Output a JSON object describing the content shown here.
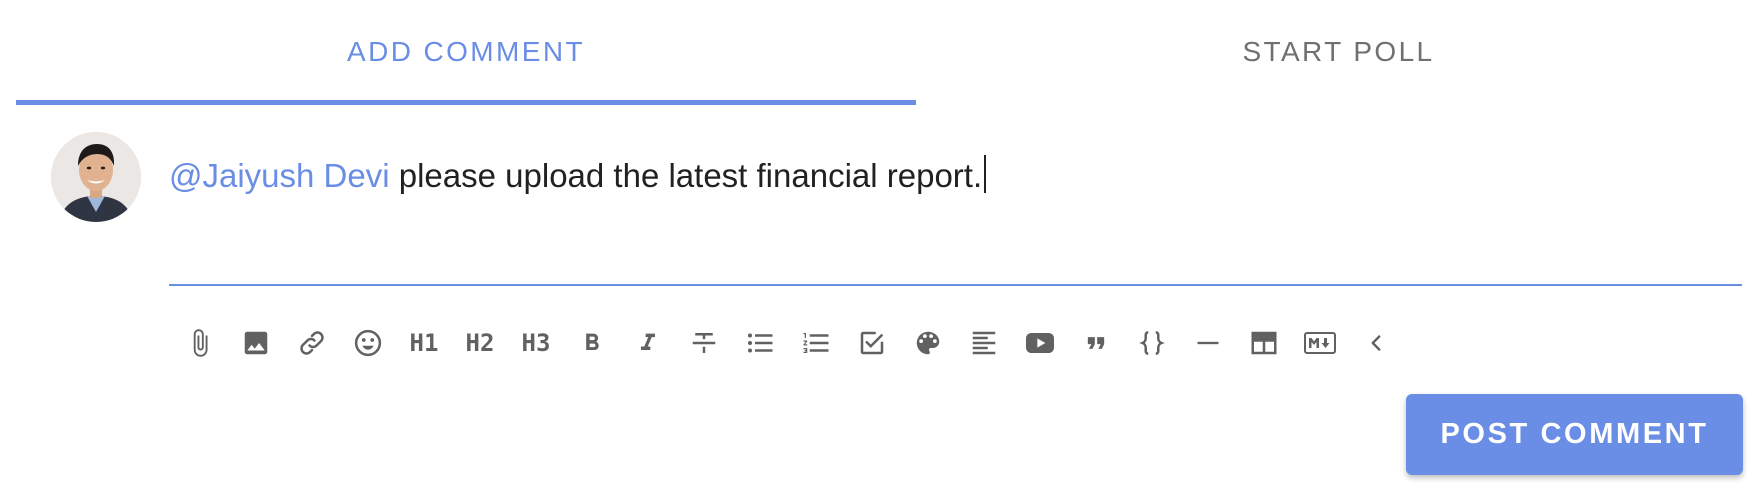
{
  "tabs": {
    "add_comment": "ADD COMMENT",
    "start_poll": "START POLL",
    "active": "add_comment"
  },
  "comment": {
    "mention": "@Jaiyush Devi",
    "body": " please upload the latest financial report."
  },
  "toolbar": {
    "icons": [
      "attach-icon",
      "image-icon",
      "link-icon",
      "emoji-icon",
      "heading-1-icon",
      "heading-2-icon",
      "heading-3-icon",
      "bold-icon",
      "italic-icon",
      "strikethrough-icon",
      "bulleted-list-icon",
      "numbered-list-icon",
      "checklist-icon",
      "color-palette-icon",
      "align-left-icon",
      "youtube-icon",
      "quote-icon",
      "code-braces-icon",
      "horizontal-rule-icon",
      "table-icon",
      "markdown-icon",
      "collapse-chevron-icon"
    ],
    "h1_label": "H1",
    "h2_label": "H2",
    "h3_label": "H3"
  },
  "post_button": {
    "label": "POST COMMENT"
  },
  "colors": {
    "accent": "#6a8de5",
    "icon": "#616161",
    "inactive_tab": "#707070",
    "text": "#212121"
  }
}
